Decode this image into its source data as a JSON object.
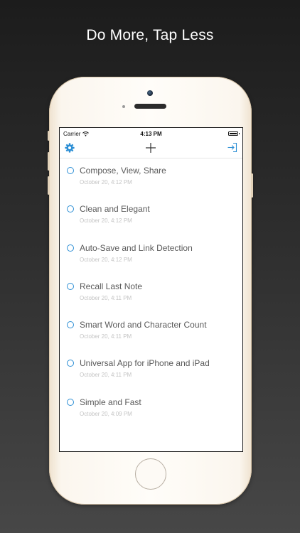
{
  "headline": "Do More, Tap Less",
  "status_bar": {
    "carrier": "Carrier",
    "time": "4:13 PM"
  },
  "toolbar": {
    "settings_icon": "gear-icon",
    "add_icon": "plus-icon",
    "exit_icon": "sign-in-icon"
  },
  "colors": {
    "accent": "#2d8fd5"
  },
  "notes": [
    {
      "title": "Compose, View, Share",
      "date": "October 20, 4:12 PM"
    },
    {
      "title": "Clean and Elegant",
      "date": "October 20, 4:12 PM"
    },
    {
      "title": "Auto-Save and Link Detection",
      "date": "October 20, 4:12 PM"
    },
    {
      "title": "Recall Last Note",
      "date": "October 20, 4:11 PM"
    },
    {
      "title": "Smart Word and Character Count",
      "date": "October 20, 4:11 PM"
    },
    {
      "title": "Universal App for iPhone and iPad",
      "date": "October 20, 4:11 PM"
    },
    {
      "title": "Simple and Fast",
      "date": "October 20, 4:09 PM"
    }
  ]
}
